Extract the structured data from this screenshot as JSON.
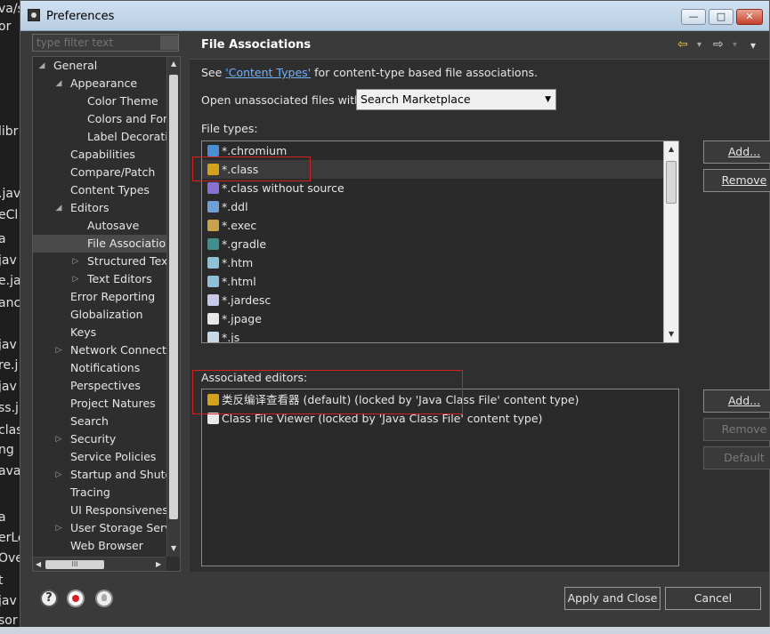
{
  "background_fragments": [
    "va/s",
    "or",
    "libr",
    ".jav",
    "eCl",
    "a",
    "jav",
    "e.ja",
    "anc",
    "jav",
    "re.j",
    "jav",
    "ss.j",
    "clas",
    "ng",
    "ava",
    "a",
    "erLo",
    "Ove",
    "t",
    "jav",
    "sor"
  ],
  "window": {
    "title": "Preferences",
    "controls": {
      "minimize": "—",
      "maximize": "□",
      "close": "✕"
    }
  },
  "filter": {
    "placeholder": "type filter text"
  },
  "tree": {
    "items": [
      {
        "label": "General",
        "twisty": "◢"
      },
      {
        "label": "Appearance",
        "twisty": "◢"
      },
      {
        "label": "Color Theme",
        "twisty": ""
      },
      {
        "label": "Colors and Fonts",
        "twisty": ""
      },
      {
        "label": "Label Decorations",
        "twisty": ""
      },
      {
        "label": "Capabilities",
        "twisty": ""
      },
      {
        "label": "Compare/Patch",
        "twisty": ""
      },
      {
        "label": "Content Types",
        "twisty": ""
      },
      {
        "label": "Editors",
        "twisty": "◢"
      },
      {
        "label": "Autosave",
        "twisty": ""
      },
      {
        "label": "File Associations",
        "twisty": ""
      },
      {
        "label": "Structured Text Editors",
        "twisty": "▷"
      },
      {
        "label": "Text Editors",
        "twisty": "▷"
      },
      {
        "label": "Error Reporting",
        "twisty": ""
      },
      {
        "label": "Globalization",
        "twisty": ""
      },
      {
        "label": "Keys",
        "twisty": ""
      },
      {
        "label": "Network Connections",
        "twisty": "▷"
      },
      {
        "label": "Notifications",
        "twisty": ""
      },
      {
        "label": "Perspectives",
        "twisty": ""
      },
      {
        "label": "Project Natures",
        "twisty": ""
      },
      {
        "label": "Search",
        "twisty": ""
      },
      {
        "label": "Security",
        "twisty": "▷"
      },
      {
        "label": "Service Policies",
        "twisty": ""
      },
      {
        "label": "Startup and Shutdown",
        "twisty": "▷"
      },
      {
        "label": "Tracing",
        "twisty": ""
      },
      {
        "label": "UI Responsiveness",
        "twisty": ""
      },
      {
        "label": "User Storage Service",
        "twisty": "▷"
      },
      {
        "label": "Web Browser",
        "twisty": ""
      }
    ],
    "selected": "File Associations",
    "hscroll_glyph": "III"
  },
  "page": {
    "title": "File Associations",
    "nav": {
      "back": "⇦",
      "forward": "⇨",
      "menu": "▾"
    },
    "see_prefix": "See ",
    "see_link": "'Content Types'",
    "see_suffix": " for content-type based file associations.",
    "open_label": "Open unassociated files with:",
    "open_value": "Search Marketplace",
    "file_types_label": "File types:",
    "file_types": [
      {
        "name": "*.chromium",
        "icon_color": "#4a8fd4"
      },
      {
        "name": "*.class",
        "icon_color": "#d6a21c"
      },
      {
        "name": "*.class without source",
        "icon_color": "#8a6fd0"
      },
      {
        "name": "*.ddl",
        "icon_color": "#6f9ed8"
      },
      {
        "name": "*.exec",
        "icon_color": "#c9a24a"
      },
      {
        "name": "*.gradle",
        "icon_color": "#3f8f8f"
      },
      {
        "name": "*.htm",
        "icon_color": "#8fc0d8"
      },
      {
        "name": "*.html",
        "icon_color": "#8fc0d8"
      },
      {
        "name": "*.jardesc",
        "icon_color": "#c8c8e8"
      },
      {
        "name": "*.jpage",
        "icon_color": "#e8e8e8"
      },
      {
        "name": "*.js",
        "icon_color": "#c8d8e8"
      }
    ],
    "selected_file_type": "*.class",
    "file_buttons": {
      "add": "Add...",
      "remove": "Remove"
    },
    "associated_label": "Associated editors:",
    "editors": [
      {
        "name": "类反编译查看器 (default) (locked by 'Java Class File' content type)",
        "icon_color": "#d6a21c"
      },
      {
        "name": "Class File Viewer (locked by 'Java Class File' content type)",
        "icon_color": "#e8e8e8"
      }
    ],
    "editor_buttons": {
      "add": "Add...",
      "remove": "Remove",
      "default": "Default"
    }
  },
  "bottom": {
    "apply_close": "Apply and Close",
    "cancel": "Cancel"
  },
  "colors": {
    "link": "#6fb3ff",
    "highlight_box": "#d02020"
  }
}
